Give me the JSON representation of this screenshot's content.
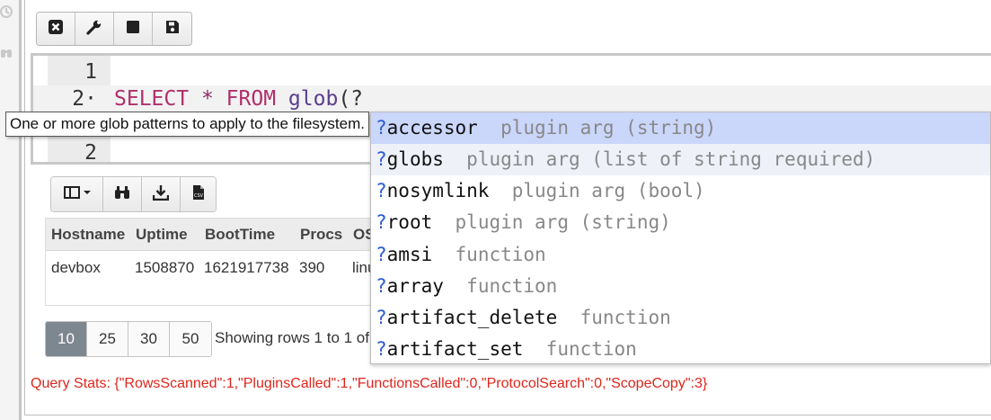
{
  "editor": {
    "line_numbers": [
      "1",
      "2·",
      "2"
    ],
    "query_keyword_select": "SELECT",
    "query_star": "*",
    "query_keyword_from": "FROM",
    "query_fn": "glob",
    "query_paren": "(?"
  },
  "tooltip": {
    "text": "One or more glob patterns to apply to the filesystem."
  },
  "autocomplete": {
    "prefix": "?",
    "items": [
      {
        "name": "accessor",
        "meta": "plugin arg (string)"
      },
      {
        "name": "globs",
        "meta": "plugin arg (list of string required)"
      },
      {
        "name": "nosymlink",
        "meta": "plugin arg (bool)"
      },
      {
        "name": "root",
        "meta": "plugin arg (string)"
      },
      {
        "name": "amsi",
        "meta": "function"
      },
      {
        "name": "array",
        "meta": "function"
      },
      {
        "name": "artifact_delete",
        "meta": "function"
      },
      {
        "name": "artifact_set",
        "meta": "function"
      }
    ]
  },
  "table": {
    "headers": [
      "Hostname",
      "Uptime",
      "BootTime",
      "Procs",
      "OS"
    ],
    "rows": [
      [
        "devbox",
        "1508870",
        "1621917738",
        "390",
        "linux"
      ]
    ]
  },
  "pager": {
    "sizes": [
      "10",
      "25",
      "30",
      "50"
    ],
    "active": "10",
    "status": "Showing rows 1 to 1 of"
  },
  "stats": {
    "text": "Query Stats: {\"RowsScanned\":1,\"PluginsCalled\":1,\"FunctionsCalled\":0,\"ProtocolSearch\":0,\"ScopeCopy\":3}"
  },
  "icons": {
    "toolbar": [
      "close-square-icon",
      "wrench-icon",
      "stop-icon",
      "save-icon"
    ],
    "result_toolbar": [
      "column-selector-icon",
      "binoculars-icon",
      "download-icon",
      "csv-file-icon"
    ],
    "rail": [
      "clock-icon",
      "binoculars-icon"
    ]
  },
  "colors": {
    "keyword": "#b0306b",
    "function": "#5a3f8c",
    "selected_suggestion": "#cad6fa",
    "stats_text": "#e0251b",
    "active_page": "#7d8790"
  }
}
